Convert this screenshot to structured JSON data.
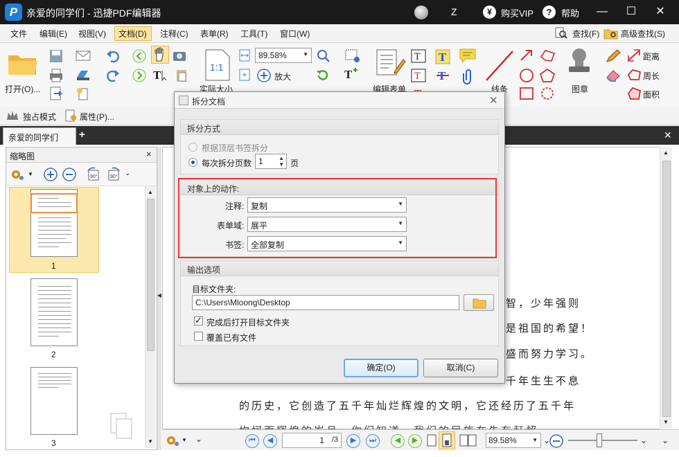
{
  "titlebar": {
    "title": "亲爱的同学们 - 迅捷PDF编辑器",
    "logo_letter": "P",
    "z_label": "Z",
    "vip": "购买VIP",
    "help": "帮助",
    "minimize": "—",
    "maximize": "☐",
    "close": "✕"
  },
  "menubar": {
    "items": [
      "文件",
      "编辑(E)",
      "视图(V)",
      "文档(D)",
      "注释(C)",
      "表单(R)",
      "工具(T)",
      "窗口(W)"
    ],
    "find": "查找(F)",
    "advanced_find": "高级查找(S)"
  },
  "ribbon": {
    "open": "打开(O)...",
    "zoom_value": "89.58%",
    "zoom_in": "放大",
    "actual_size": "实际大小",
    "fit_label": "1:1",
    "edit_form": "编辑表单",
    "line": "线条",
    "stamp": "图章",
    "distance": "距离",
    "perimeter": "周长",
    "area": "面积"
  },
  "secondbar": {
    "exclusive_mode": "独占模式",
    "properties": "属性(P)..."
  },
  "tabs": {
    "doc_tab": "亲爱的同学们",
    "add": "+",
    "close": "✕"
  },
  "left_panel": {
    "title": "缩略图",
    "close": "×",
    "pages": [
      "1",
      "2",
      "3"
    ]
  },
  "document": {
    "lines": [
      "智，少年强则",
      "是祖国的希望！",
      "盛而努力学习。",
      "千年生生不息",
      "的历史，它创造了五千年灿烂辉煌的文明，它还经历了五千年",
      "坎坷而辉煌的岁月，你们知道，我们的民族在先有赶超"
    ]
  },
  "bottombar": {
    "page_value": "1",
    "page_total": "/3",
    "zoom_value": "89.58%"
  },
  "dialog": {
    "title": "拆分文档",
    "close": "✕",
    "split_mode": {
      "header": "拆分方式",
      "option_bookmark": "根据顶层书签拆分",
      "option_pages": "每次拆分页数",
      "pages_value": "1",
      "pages_unit": "页"
    },
    "actions": {
      "header": "对象上的动作:",
      "annotation_label": "注释:",
      "annotation_value": "复制",
      "form_label": "表单域:",
      "form_value": "展平",
      "bookmark_label": "书签:",
      "bookmark_value": "全部复制"
    },
    "output": {
      "header": "输出选项",
      "folder_label": "目标文件夹:",
      "folder_value": "C:\\Users\\Mloong\\Desktop",
      "open_after": "完成后打开目标文件夹",
      "overwrite": "覆盖已有文件"
    },
    "ok": "确定(O)",
    "cancel": "取消(C)"
  },
  "colors": {
    "titlebar": "#1a1a1a",
    "highlight_box": "#e23a3a",
    "menu_active": "#fde5a2",
    "accent_blue": "#1e7fd8"
  }
}
